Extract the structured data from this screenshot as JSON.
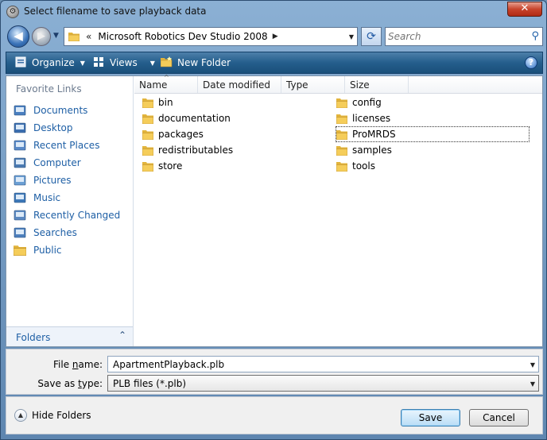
{
  "window": {
    "title": "Select filename to save playback data",
    "close_label": "✕"
  },
  "nav": {
    "back_glyph": "◀",
    "forward_glyph": "▶",
    "address_chevron": "«",
    "address_path": "Microsoft Robotics Dev Studio 2008",
    "address_arrow": "▶",
    "search_placeholder": "Search"
  },
  "toolbar": {
    "organize_label": "Organize",
    "views_label": "Views",
    "new_folder_label": "New Folder",
    "help_label": "?"
  },
  "favorites": {
    "title": "Favorite Links",
    "items": [
      {
        "label": "Documents",
        "icon": "documents-icon"
      },
      {
        "label": "Desktop",
        "icon": "desktop-icon"
      },
      {
        "label": "Recent Places",
        "icon": "recent-places-icon"
      },
      {
        "label": "Computer",
        "icon": "computer-icon"
      },
      {
        "label": "Pictures",
        "icon": "pictures-icon"
      },
      {
        "label": "Music",
        "icon": "music-icon"
      },
      {
        "label": "Recently Changed",
        "icon": "recently-changed-icon"
      },
      {
        "label": "Searches",
        "icon": "searches-icon"
      },
      {
        "label": "Public",
        "icon": "public-folder-icon"
      }
    ],
    "folders_label": "Folders"
  },
  "columns": [
    "Name",
    "Date modified",
    "Type",
    "Size"
  ],
  "files": {
    "left": [
      "bin",
      "documentation",
      "packages",
      "redistributables",
      "store"
    ],
    "right": [
      "config",
      "licenses",
      "ProMRDS",
      "samples",
      "tools"
    ]
  },
  "form": {
    "filename_label_pre": "File ",
    "filename_label_ul": "n",
    "filename_label_post": "ame:",
    "filename_value": "ApartmentPlayback.plb",
    "savetype_label_pre": "Save as ",
    "savetype_label_ul": "t",
    "savetype_label_post": "ype:",
    "savetype_value": "PLB files (*.plb)"
  },
  "actions": {
    "hide_folders_label": "Hide Folders",
    "save_label": "Save",
    "cancel_label": "Cancel"
  },
  "colors": {
    "link": "#1e5fa5",
    "command_bar": "#245e8c",
    "folder": "#f5cd5a"
  }
}
